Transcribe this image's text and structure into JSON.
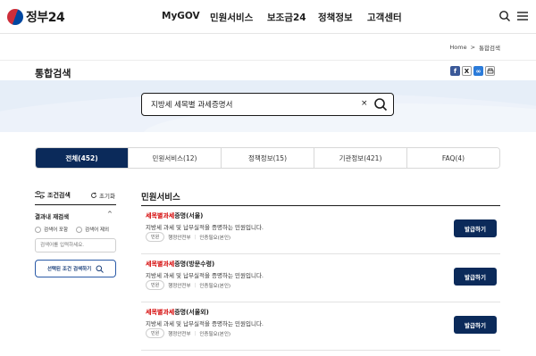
{
  "header": {
    "logo_text": "정부24",
    "nav": [
      "MyGOV",
      "민원서비스",
      "보조금24",
      "정책정보",
      "고객센터"
    ]
  },
  "breadcrumb": [
    "Home",
    ">",
    "통합검색"
  ],
  "page_title": "통합검색",
  "search": {
    "value": "지방세 세목별 과세증명서",
    "clear": "×"
  },
  "tabs": [
    {
      "label": "전체(452)",
      "active": true
    },
    {
      "label": "민원서비스(12)",
      "active": false
    },
    {
      "label": "정책정보(15)",
      "active": false
    },
    {
      "label": "기관정보(421)",
      "active": false
    },
    {
      "label": "FAQ(4)",
      "active": false
    }
  ],
  "filter": {
    "title": "조건검색",
    "reset": "초기화",
    "within_title": "결과내 재검색",
    "within_chevron": "^",
    "options": [
      "검색어 포함",
      "검색어 제외"
    ],
    "input_placeholder": "검색어를 입력하세요.",
    "button": "선택된 조건 검색하기"
  },
  "results": {
    "section_title": "민원서비스",
    "items": [
      {
        "title_hl": "세목별과세",
        "title_rest": "증명(서울)",
        "desc": "지방세 과세 및 납부실적을 증명하는 민원입니다.",
        "badge": "민원",
        "agency": "행정안전부",
        "auth": "인증필요(본인)",
        "button": "발급하기"
      },
      {
        "title_hl": "세목별과세",
        "title_rest": "증명(방문수령)",
        "desc": "지방세 과세 및 납부실적을 증명하는 민원입니다.",
        "badge": "민원",
        "agency": "행정안전부",
        "auth": "인증필요(본인)",
        "button": "발급하기"
      },
      {
        "title_hl": "세목별과세",
        "title_rest": "증명(서울외)",
        "desc": "지방세 과세 및 납부실적을 증명하는 민원입니다.",
        "badge": "민원",
        "agency": "행정안전부",
        "auth": "인증필요(본인)",
        "button": "발급하기"
      }
    ]
  },
  "colors": {
    "primary": "#0b2a5a",
    "highlight": "#d40000",
    "band": "#e6eef8"
  }
}
